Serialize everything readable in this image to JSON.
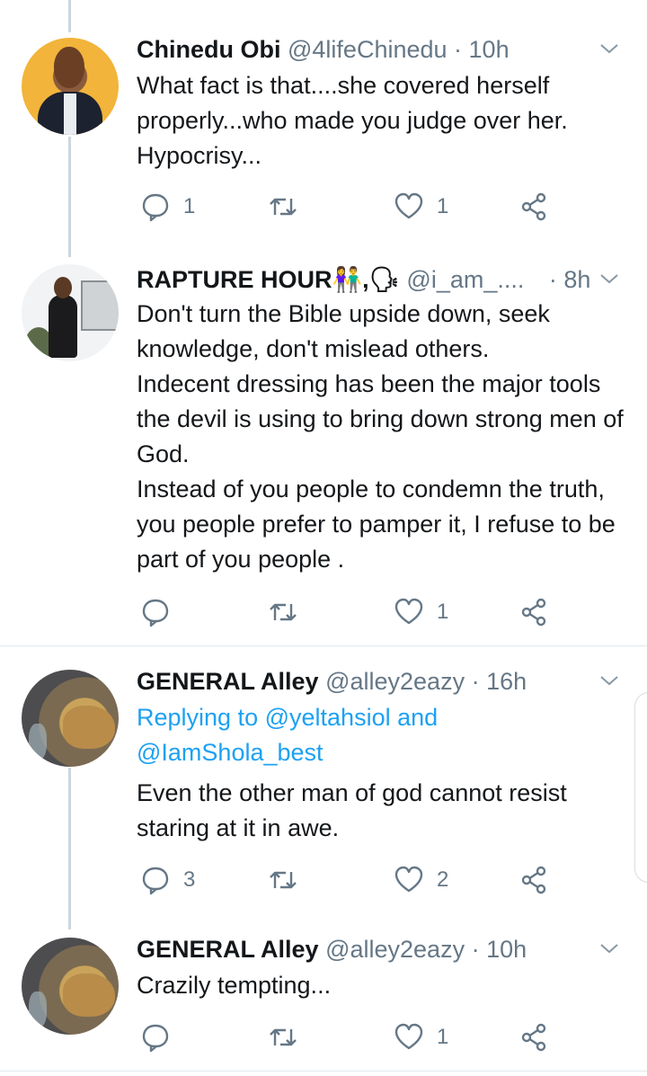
{
  "tweets": [
    {
      "name": "Chinedu Obi",
      "handle": "@4lifeChinedu",
      "time": "· 10h",
      "body": "What fact is that....she covered herself properly...who made you judge over her. Hypocrisy...",
      "reply_count": "1",
      "retweet_count": "",
      "like_count": "1"
    },
    {
      "name": "RAPTURE HOUR👫,🗣",
      "handle": "@i_am_....",
      "time": "· 8h",
      "body": "Don't turn the Bible upside down, seek knowledge, don't  mislead others.\nIndecent dressing has been the major tools the devil is using to bring down strong men of God.\nInstead of you people to condemn the truth, you people prefer to pamper it, I refuse to be part of you people .",
      "reply_count": "",
      "retweet_count": "",
      "like_count": "1"
    },
    {
      "name": "GENERAL Alley",
      "handle": "@alley2eazy",
      "time": "· 16h",
      "replying_prefix": "Replying to",
      "replying_user1": "@yeltahsiol",
      "replying_and": "and",
      "replying_user2": "@IamShola_best",
      "body": "Even the other man of god cannot resist staring at it in awe.",
      "reply_count": "3",
      "retweet_count": "",
      "like_count": "2"
    },
    {
      "name": "GENERAL Alley",
      "handle": "@alley2eazy",
      "time": "· 10h",
      "body": "Crazily tempting...",
      "reply_count": "",
      "retweet_count": "",
      "like_count": "1"
    }
  ],
  "icons": {
    "reply": "reply-icon",
    "retweet": "retweet-icon",
    "like": "heart-icon",
    "share": "share-icon",
    "menu": "chevron-down-icon"
  },
  "colors": {
    "text": "#14171a",
    "muted": "#657786",
    "link": "#1da1f2",
    "divider": "#e1e8ed",
    "thread": "#ccd6dd"
  }
}
